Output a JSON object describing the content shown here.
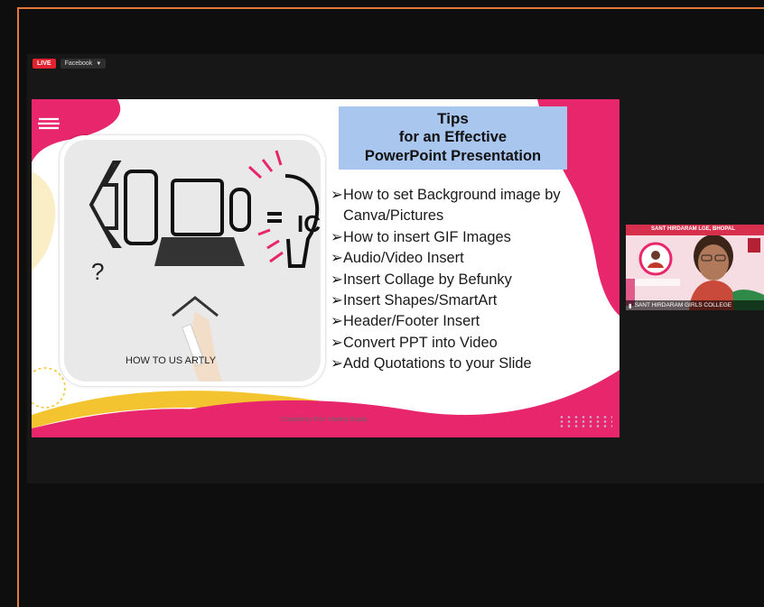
{
  "toolbar": {
    "live_label": "LIVE",
    "platform_label": "Facebook"
  },
  "slide": {
    "title": "Tips",
    "subtitle_line1": "for an Effective",
    "subtitle_line2": "PowerPoint Presentation",
    "bullets": [
      "How to set Background image by",
      "Canva/Pictures",
      "How to insert GIF Images",
      "Audio/Video Insert",
      "Insert Collage by Befunky",
      "Insert Shapes/SmartArt",
      "Header/Footer Insert",
      "Convert PPT into Video",
      "Add Quotations to your Slide"
    ],
    "illustration_text": "HOW TO US  ARTLY",
    "credit": "Created by Prof. Mamta Gupta"
  },
  "participant": {
    "name": "SANT HIRDARAM GIRLS COLLEGE",
    "banner_text": "SANT HIRDARAM  LGE, BHOPAL"
  },
  "colors": {
    "accent_pink": "#e8266c",
    "accent_yellow": "#f4c430",
    "live_red": "#e0232e",
    "frame_orange": "#e2783a",
    "tips_box": "#a9c6ee"
  }
}
